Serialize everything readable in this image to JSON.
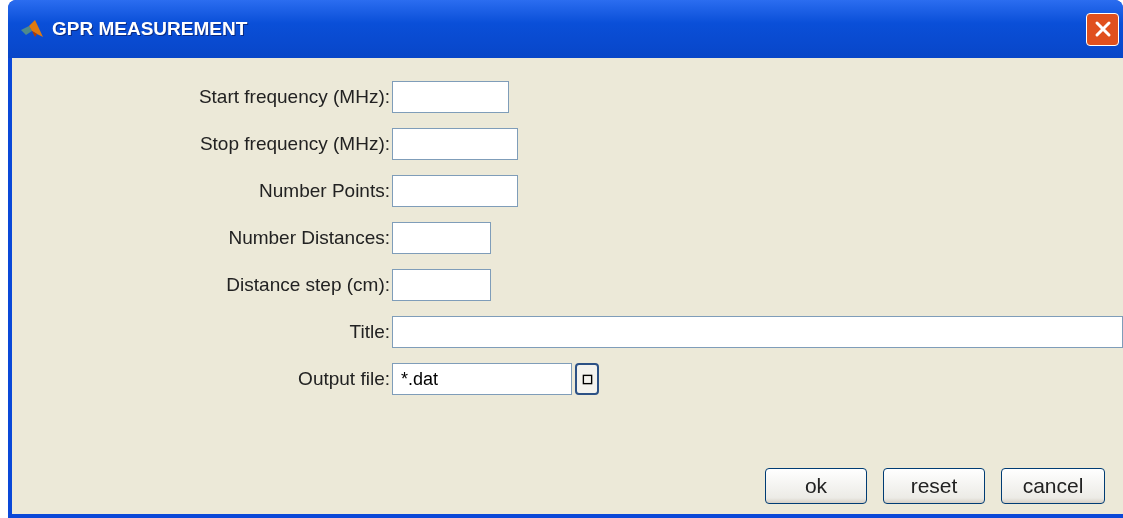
{
  "window": {
    "title": "GPR MEASUREMENT"
  },
  "fields": [
    {
      "label": "Start frequency (MHz):"
    },
    {
      "label": "Stop frequency (MHz):"
    },
    {
      "label": "Number Points:"
    },
    {
      "label": "Number Distances:"
    },
    {
      "label": "Distance step (cm):"
    },
    {
      "label": "Title:"
    },
    {
      "label": "Output file:",
      "value": "*.dat",
      "kind": "file"
    }
  ],
  "buttons": [
    "ok",
    "reset",
    "cancel"
  ]
}
